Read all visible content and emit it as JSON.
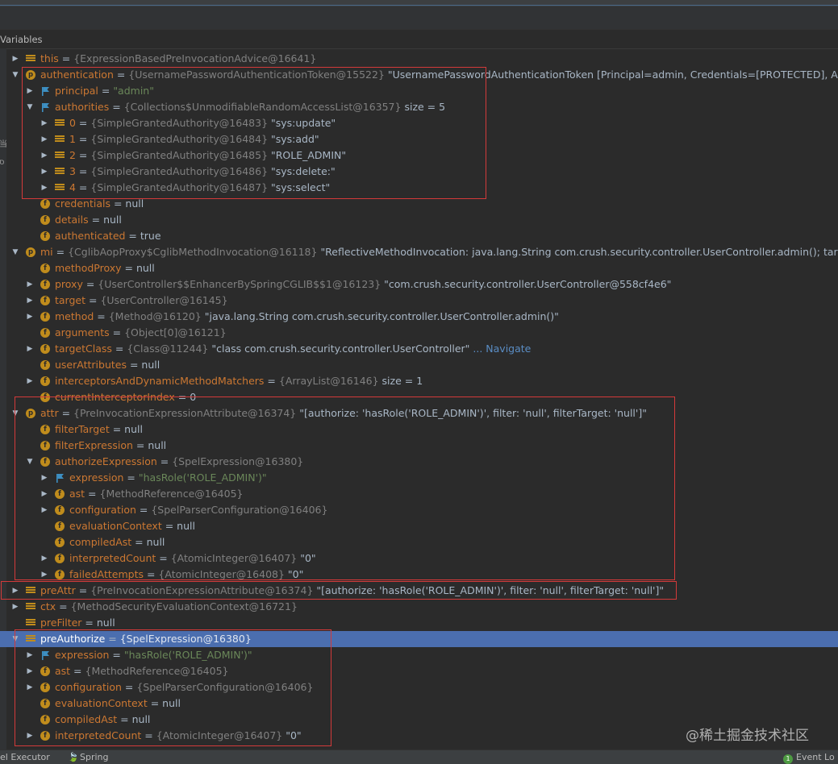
{
  "panel": {
    "title": "Variables"
  },
  "gutter": [
    "当",
    "ס"
  ],
  "rows": [
    {
      "indent": 0,
      "arrow": "right",
      "icon": "var",
      "name": "this",
      "type": "{ExpressionBasedPreInvocationAdvice@16641}",
      "value": ""
    },
    {
      "indent": 0,
      "arrow": "down",
      "icon": "param",
      "name": "authentication",
      "type": "{UsernamePasswordAuthenticationToken@15522}",
      "value": "\"UsernamePasswordAuthenticationToken [Principal=admin, Credentials=[PROTECTED], Authenticated=t"
    },
    {
      "indent": 1,
      "arrow": "right",
      "icon": "flag",
      "name": "principal",
      "type": "",
      "value": "\"admin\"",
      "valueStyle": "green"
    },
    {
      "indent": 1,
      "arrow": "down",
      "icon": "flag",
      "name": "authorities",
      "type": "{Collections$UnmodifiableRandomAccessList@16357}",
      "value": " size = 5"
    },
    {
      "indent": 2,
      "arrow": "right",
      "icon": "var",
      "name": "0",
      "type": "{SimpleGrantedAuthority@16483}",
      "value": "\"sys:update\""
    },
    {
      "indent": 2,
      "arrow": "right",
      "icon": "var",
      "name": "1",
      "type": "{SimpleGrantedAuthority@16484}",
      "value": "\"sys:add\""
    },
    {
      "indent": 2,
      "arrow": "right",
      "icon": "var",
      "name": "2",
      "type": "{SimpleGrantedAuthority@16485}",
      "value": "\"ROLE_ADMIN\""
    },
    {
      "indent": 2,
      "arrow": "right",
      "icon": "var",
      "name": "3",
      "type": "{SimpleGrantedAuthority@16486}",
      "value": "\"sys:delete:\""
    },
    {
      "indent": 2,
      "arrow": "right",
      "icon": "var",
      "name": "4",
      "type": "{SimpleGrantedAuthority@16487}",
      "value": "\"sys:select\""
    },
    {
      "indent": 1,
      "arrow": "",
      "icon": "field",
      "name": "credentials",
      "type": "",
      "value": "null"
    },
    {
      "indent": 1,
      "arrow": "",
      "icon": "field",
      "name": "details",
      "type": "",
      "value": "null"
    },
    {
      "indent": 1,
      "arrow": "",
      "icon": "field",
      "name": "authenticated",
      "type": "",
      "value": "true"
    },
    {
      "indent": 0,
      "arrow": "down",
      "icon": "param",
      "name": "mi",
      "type": "{CglibAopProxy$CglibMethodInvocation@16118}",
      "value": "\"ReflectiveMethodInvocation: java.lang.String com.crush.security.controller.UserController.admin(); target is of class"
    },
    {
      "indent": 1,
      "arrow": "",
      "icon": "field",
      "name": "methodProxy",
      "type": "",
      "value": "null"
    },
    {
      "indent": 1,
      "arrow": "right",
      "icon": "field",
      "name": "proxy",
      "type": "{UserController$$EnhancerBySpringCGLIB$$1@16123}",
      "value": "\"com.crush.security.controller.UserController@558cf4e6\""
    },
    {
      "indent": 1,
      "arrow": "right",
      "icon": "field",
      "name": "target",
      "type": "{UserController@16145}",
      "value": ""
    },
    {
      "indent": 1,
      "arrow": "right",
      "icon": "field",
      "name": "method",
      "type": "{Method@16120}",
      "value": "\"java.lang.String com.crush.security.controller.UserController.admin()\""
    },
    {
      "indent": 1,
      "arrow": "",
      "icon": "field",
      "name": "arguments",
      "type": "{Object[0]@16121}",
      "value": ""
    },
    {
      "indent": 1,
      "arrow": "right",
      "icon": "field",
      "name": "targetClass",
      "type": "{Class@11244}",
      "value": "\"class com.crush.security.controller.UserController\"",
      "link": "... Navigate"
    },
    {
      "indent": 1,
      "arrow": "",
      "icon": "field",
      "name": "userAttributes",
      "type": "",
      "value": "null"
    },
    {
      "indent": 1,
      "arrow": "right",
      "icon": "field",
      "name": "interceptorsAndDynamicMethodMatchers",
      "type": "{ArrayList@16146}",
      "value": " size = 1"
    },
    {
      "indent": 1,
      "arrow": "",
      "icon": "field",
      "name": "currentInterceptorIndex",
      "type": "",
      "value": "0"
    },
    {
      "indent": 0,
      "arrow": "down",
      "icon": "param",
      "name": "attr",
      "type": "{PreInvocationExpressionAttribute@16374}",
      "value": "\"[authorize: 'hasRole('ROLE_ADMIN')', filter: 'null', filterTarget: 'null']\""
    },
    {
      "indent": 1,
      "arrow": "",
      "icon": "field",
      "name": "filterTarget",
      "type": "",
      "value": "null"
    },
    {
      "indent": 1,
      "arrow": "",
      "icon": "field",
      "name": "filterExpression",
      "type": "",
      "value": "null"
    },
    {
      "indent": 1,
      "arrow": "down",
      "icon": "field",
      "name": "authorizeExpression",
      "type": "{SpelExpression@16380}",
      "value": ""
    },
    {
      "indent": 2,
      "arrow": "right",
      "icon": "flag",
      "name": "expression",
      "type": "",
      "value": "\"hasRole('ROLE_ADMIN')\"",
      "valueStyle": "green"
    },
    {
      "indent": 2,
      "arrow": "right",
      "icon": "field",
      "name": "ast",
      "type": "{MethodReference@16405}",
      "value": ""
    },
    {
      "indent": 2,
      "arrow": "right",
      "icon": "field",
      "name": "configuration",
      "type": "{SpelParserConfiguration@16406}",
      "value": ""
    },
    {
      "indent": 2,
      "arrow": "",
      "icon": "field",
      "name": "evaluationContext",
      "type": "",
      "value": "null"
    },
    {
      "indent": 2,
      "arrow": "",
      "icon": "field",
      "name": "compiledAst",
      "type": "",
      "value": "null"
    },
    {
      "indent": 2,
      "arrow": "right",
      "icon": "field",
      "name": "interpretedCount",
      "type": "{AtomicInteger@16407}",
      "value": "\"0\""
    },
    {
      "indent": 2,
      "arrow": "right",
      "icon": "field",
      "name": "failedAttempts",
      "type": "{AtomicInteger@16408}",
      "value": "\"0\""
    },
    {
      "indent": 0,
      "arrow": "right",
      "icon": "var",
      "name": "preAttr",
      "type": "{PreInvocationExpressionAttribute@16374}",
      "value": "\"[authorize: 'hasRole('ROLE_ADMIN')', filter: 'null', filterTarget: 'null']\""
    },
    {
      "indent": 0,
      "arrow": "right",
      "icon": "var",
      "name": "ctx",
      "type": "{MethodSecurityEvaluationContext@16721}",
      "value": ""
    },
    {
      "indent": 0,
      "arrow": "",
      "icon": "var",
      "name": "preFilter",
      "type": "",
      "value": "null"
    },
    {
      "indent": 0,
      "arrow": "down",
      "icon": "var",
      "name": "preAuthorize",
      "type": "{SpelExpression@16380}",
      "value": "",
      "selected": true
    },
    {
      "indent": 1,
      "arrow": "right",
      "icon": "flag",
      "name": "expression",
      "type": "",
      "value": "\"hasRole('ROLE_ADMIN')\"",
      "valueStyle": "green"
    },
    {
      "indent": 1,
      "arrow": "right",
      "icon": "field",
      "name": "ast",
      "type": "{MethodReference@16405}",
      "value": ""
    },
    {
      "indent": 1,
      "arrow": "right",
      "icon": "field",
      "name": "configuration",
      "type": "{SpelParserConfiguration@16406}",
      "value": ""
    },
    {
      "indent": 1,
      "arrow": "",
      "icon": "field",
      "name": "evaluationContext",
      "type": "",
      "value": "null"
    },
    {
      "indent": 1,
      "arrow": "",
      "icon": "field",
      "name": "compiledAst",
      "type": "",
      "value": "null"
    },
    {
      "indent": 1,
      "arrow": "right",
      "icon": "field",
      "name": "interpretedCount",
      "type": "{AtomicInteger@16407}",
      "value": "\"0\""
    }
  ],
  "bottom": {
    "left_tab": "el Executor",
    "spring_tab": "Spring",
    "event_log": "Event Lo",
    "event_count": "1"
  },
  "watermark": "@稀土掘金技术社区",
  "colors": {
    "highlight_box": "#d33a3a",
    "selection": "#4b6eaf",
    "field_icon": "#c08c1c"
  }
}
